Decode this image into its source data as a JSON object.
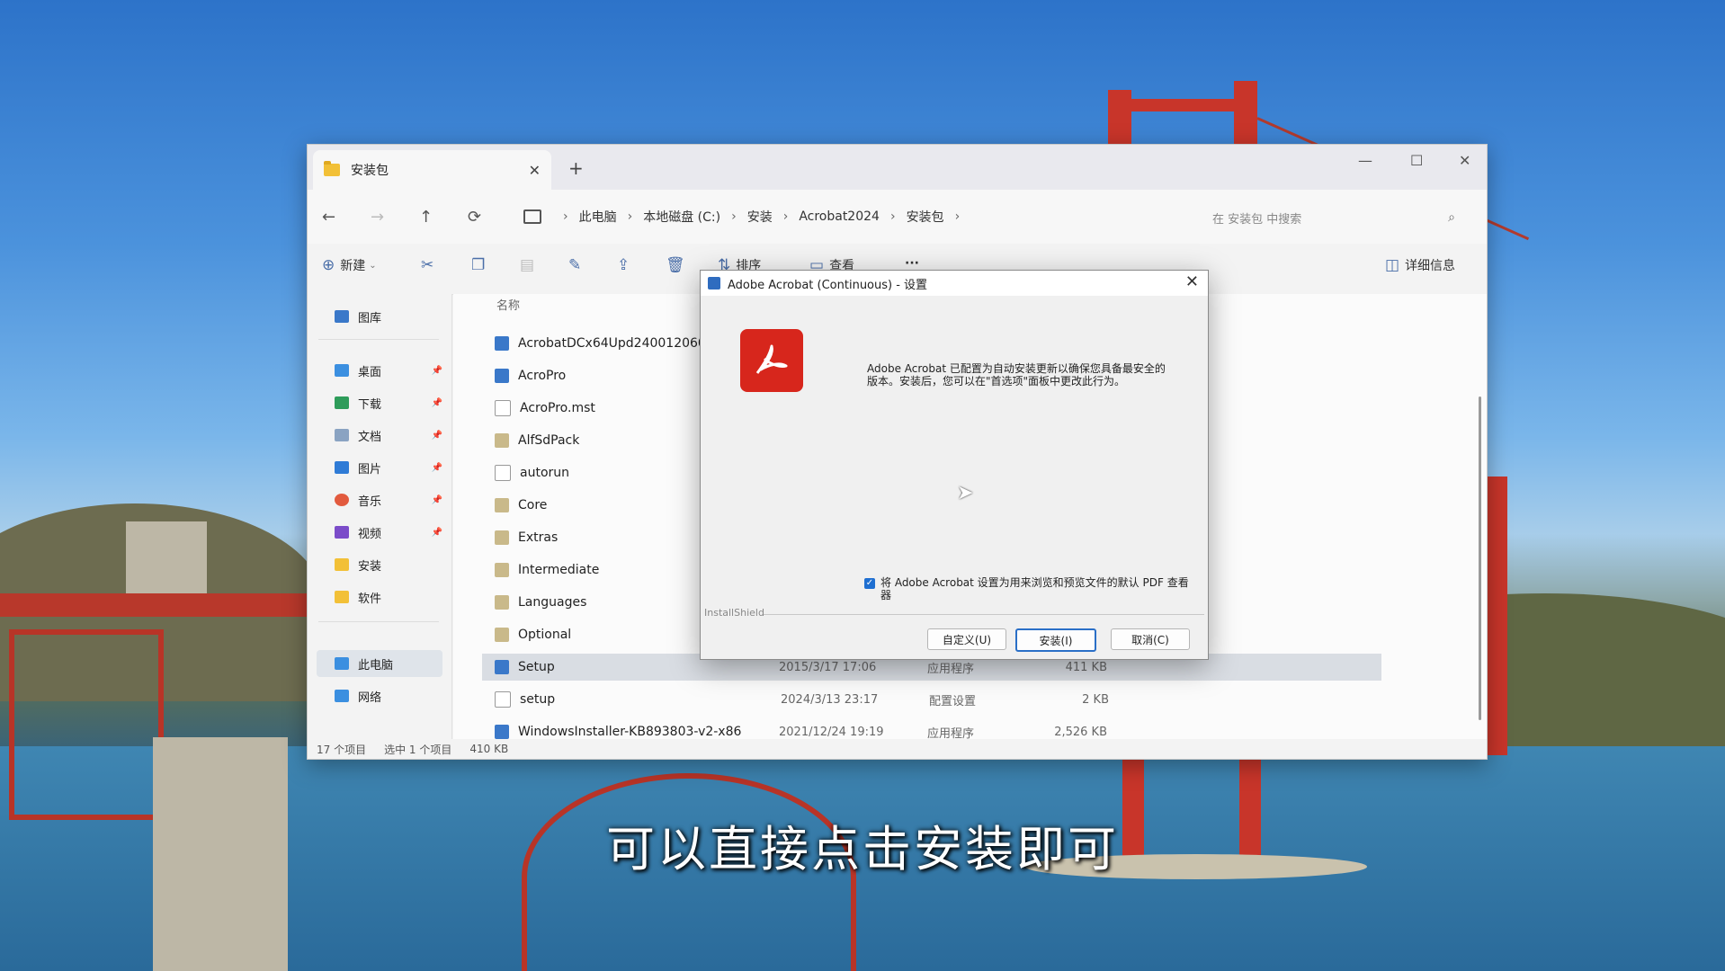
{
  "explorer": {
    "tab_title": "安装包",
    "tab_close": "✕",
    "new_tab": "+",
    "window_controls": [
      "—",
      "☐",
      "✕"
    ],
    "nav": {
      "back": "←",
      "forward": "→",
      "up": "↑",
      "refresh": "⟳"
    },
    "breadcrumb": [
      "此电脑",
      "本地磁盘 (C:)",
      "安装",
      "Acrobat2024",
      "安装包"
    ],
    "breadcrumb_sep": "›",
    "search_placeholder": "在 安装包 中搜索",
    "toolbar": {
      "new": "新建",
      "sort": "排序",
      "view": "查看",
      "more": "···",
      "details": "详细信息"
    },
    "sidebar": {
      "gallery": "图库",
      "quick_access": [
        "桌面",
        "下载",
        "文档",
        "图片",
        "音乐",
        "视频",
        "安装",
        "软件"
      ],
      "this_pc": "此电脑",
      "network": "网络"
    },
    "column_name": "名称",
    "files": [
      {
        "name": "AcrobatDCx64Upd2400120604",
        "date": "",
        "type": "",
        "size": ""
      },
      {
        "name": "AcroPro",
        "date": "",
        "type": "",
        "size": ""
      },
      {
        "name": "AcroPro.mst",
        "date": "",
        "type": "",
        "size": ""
      },
      {
        "name": "AlfSdPack",
        "date": "",
        "type": "",
        "size": ""
      },
      {
        "name": "autorun",
        "date": "",
        "type": "",
        "size": ""
      },
      {
        "name": "Core",
        "date": "",
        "type": "",
        "size": ""
      },
      {
        "name": "Extras",
        "date": "",
        "type": "",
        "size": ""
      },
      {
        "name": "Intermediate",
        "date": "",
        "type": "",
        "size": ""
      },
      {
        "name": "Languages",
        "date": "",
        "type": "",
        "size": ""
      },
      {
        "name": "Optional",
        "date": "",
        "type": "",
        "size": ""
      },
      {
        "name": "Setup",
        "date": "2015/3/17 17:06",
        "type": "应用程序",
        "size": "411 KB"
      },
      {
        "name": "setup",
        "date": "2024/3/13 23:17",
        "type": "配置设置",
        "size": "2 KB"
      },
      {
        "name": "WindowsInstaller-KB893803-v2-x86",
        "date": "2021/12/24 19:19",
        "type": "应用程序",
        "size": "2,526 KB"
      }
    ],
    "status": {
      "count": "17 个项目",
      "selected": "选中 1 个项目",
      "size": "410 KB"
    }
  },
  "dialog": {
    "title": "Adobe Acrobat (Continuous) - 设置",
    "close": "✕",
    "message": "Adobe Acrobat 已配置为自动安装更新以确保您具备最安全的版本。安装后，您可以在\"首选项\"面板中更改此行为。",
    "checkbox_label": "将 Adobe Acrobat 设置为用来浏览和预览文件的默认 PDF 查看器",
    "checkbox_checked": true,
    "installshield": "InstallShield",
    "buttons": {
      "customize": "自定义(U)",
      "install": "安装(I)",
      "cancel": "取消(C)"
    }
  },
  "subtitle": "可以直接点击安装即可",
  "colors": {
    "accent": "#2a6fc7",
    "adobe_red": "#d7261c",
    "folder": "#f2c037"
  }
}
